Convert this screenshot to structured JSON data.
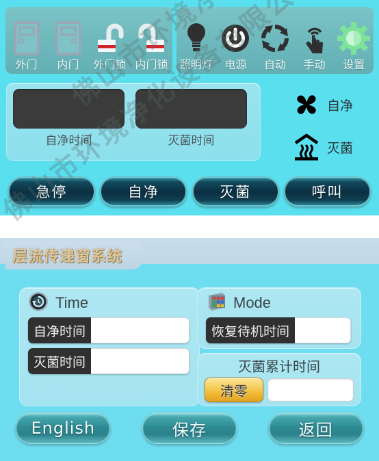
{
  "watermark": "佛山市环境净化设备有限公司",
  "screen1": {
    "toolbar": {
      "left_group": [
        {
          "label": "外门",
          "icon": "door-icon"
        },
        {
          "label": "内门",
          "icon": "door-icon"
        },
        {
          "label": "外门锁",
          "icon": "unlocked-padlock-icon"
        },
        {
          "label": "内门锁",
          "icon": "unlocked-padlock-icon"
        }
      ],
      "right_group": [
        {
          "label": "照明灯",
          "icon": "lightbulb-icon"
        },
        {
          "label": "电源",
          "icon": "power-icon"
        },
        {
          "label": "自动",
          "icon": "cycle-arrows-icon"
        },
        {
          "label": "手动",
          "icon": "hand-tap-icon"
        },
        {
          "label": "设置",
          "icon": "gear-icon"
        }
      ]
    },
    "display": {
      "boxes": [
        {
          "label": "自净时间",
          "value": ""
        },
        {
          "label": "灭菌时间",
          "value": ""
        }
      ]
    },
    "status": [
      {
        "label": "自净",
        "icon": "fan-icon"
      },
      {
        "label": "灭菌",
        "icon": "uv-lamp-icon"
      }
    ],
    "buttons": [
      {
        "label": "急停"
      },
      {
        "label": "自净"
      },
      {
        "label": "灭菌"
      },
      {
        "label": "呼叫"
      }
    ]
  },
  "screen2": {
    "title": "层流传递窗系统",
    "time_card": {
      "heading": "Time",
      "icon": "clock-history-icon",
      "fields": [
        {
          "label": "自净时间",
          "value": ""
        },
        {
          "label": "灭菌时间",
          "value": ""
        }
      ]
    },
    "mode_card": {
      "heading": "Mode",
      "icon": "keypad-grid-icon",
      "fields": [
        {
          "label": "恢复待机时间",
          "value": ""
        }
      ]
    },
    "total_card": {
      "title": "灭菌累计时间",
      "clear_button": "清零",
      "value": ""
    },
    "buttons": [
      {
        "label": "English"
      },
      {
        "label": "保存"
      },
      {
        "label": "返回"
      }
    ]
  },
  "colors": {
    "screen_bg": "#5ADFEE",
    "toolbar_panel": "#6DB8BC",
    "display_panel": "#8CDFEC",
    "display_box": "#3B3B3B",
    "dark_button": "#0B2F42",
    "teal_button": "#2E8B93",
    "title_gold": "#E0C79A",
    "clear_button": "#F6CB55"
  }
}
